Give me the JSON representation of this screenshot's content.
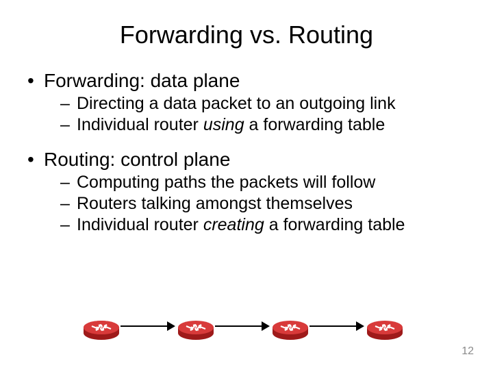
{
  "title": "Forwarding vs. Routing",
  "bullets": {
    "a": {
      "head": "Forwarding: data plane",
      "subs": {
        "a1": "Directing a data packet to an outgoing link",
        "a2_pre": "Individual router ",
        "a2_em": "using",
        "a2_post": " a forwarding table"
      }
    },
    "b": {
      "head": "Routing: control plane",
      "subs": {
        "b1": "Computing paths the packets will follow",
        "b2": "Routers talking amongst themselves",
        "b3_pre": "Individual router ",
        "b3_em": "creating",
        "b3_post": " a forwarding table"
      }
    }
  },
  "page_number": "12",
  "icons": {
    "router": "router-icon"
  }
}
